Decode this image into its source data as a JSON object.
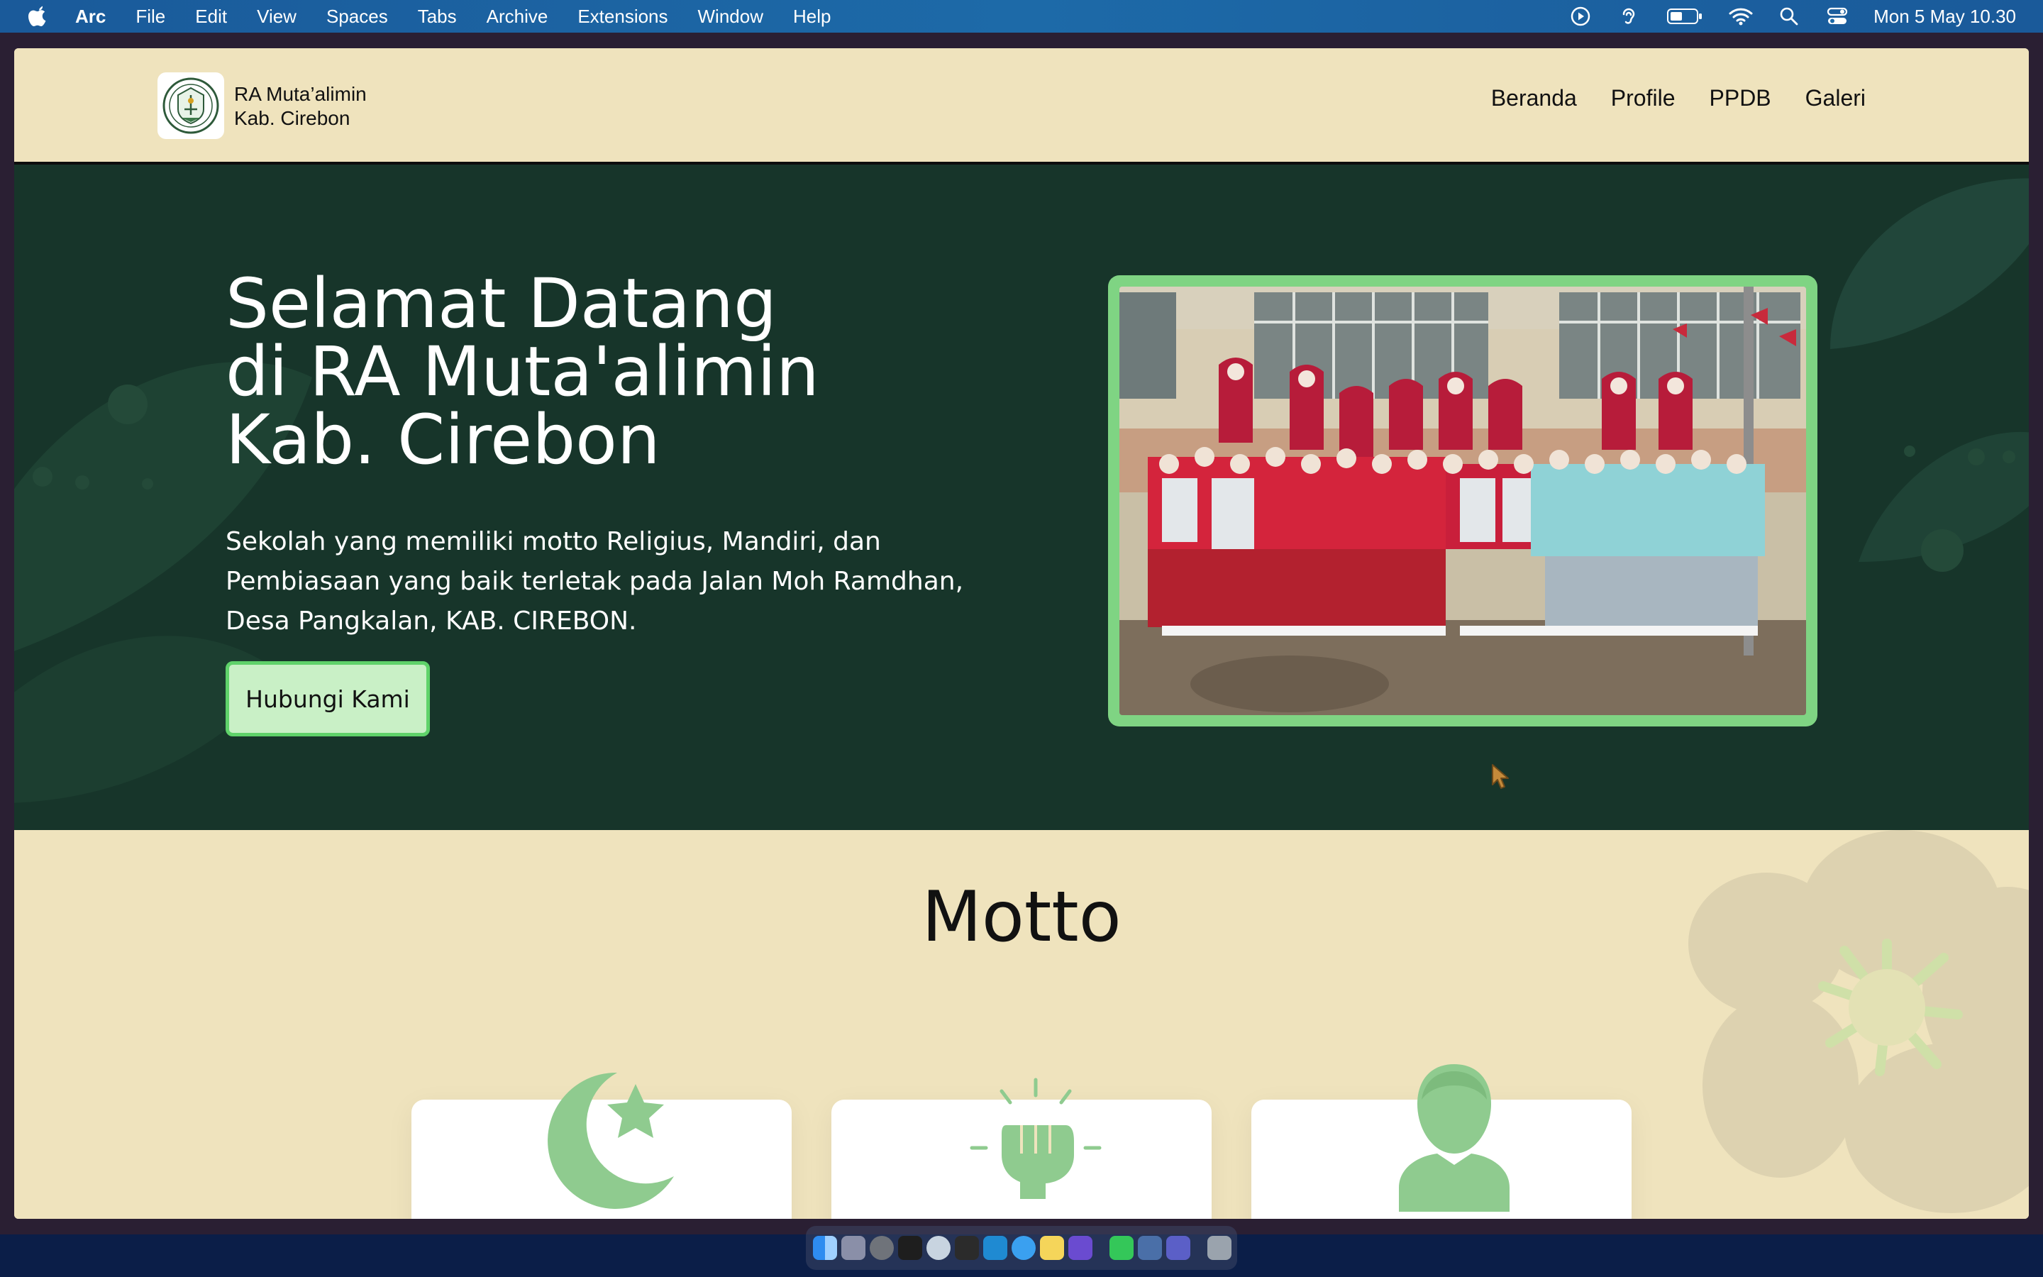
{
  "menubar": {
    "app_name": "Arc",
    "items": [
      "File",
      "Edit",
      "View",
      "Spaces",
      "Tabs",
      "Archive",
      "Extensions",
      "Window",
      "Help"
    ],
    "clock": "Mon 5 May  10.30",
    "status_icons": [
      "play-circle-icon",
      "hearing-icon",
      "battery-icon",
      "wifi-icon",
      "search-icon",
      "control-center-icon"
    ]
  },
  "site": {
    "brand_line1": "RA Muta’alimin",
    "brand_line2": "Kab. Cirebon",
    "nav": [
      "Beranda",
      "Profile",
      "PPDB",
      "Galeri"
    ]
  },
  "hero": {
    "title_lines": [
      "Selamat Datang",
      "di RA Muta'alimin",
      "Kab. Cirebon"
    ],
    "description": "Sekolah yang memiliki motto Religius, Mandiri, dan Pembiasaan yang baik terletak pada Jalan Moh Ramdhan, Desa Pangkalan, KAB. CIREBON.",
    "cta_label": "Hubungi Kami"
  },
  "motto": {
    "title": "Motto",
    "cards": [
      {
        "icon": "crescent-star-icon"
      },
      {
        "icon": "raised-fist-icon"
      },
      {
        "icon": "person-icon"
      }
    ]
  },
  "colors": {
    "hero_bg": "#17352a",
    "cream": "#efe3bd",
    "accent_green": "#7fd483",
    "icon_green": "#8fcb8f"
  },
  "dock": {
    "apps": [
      "finder-icon",
      "launchpad-icon",
      "system-settings-icon",
      "terminal-icon",
      "disk-utility-icon",
      "console-icon",
      "vscode-icon",
      "safari-icon",
      "notes-icon",
      "photo-app-icon",
      "whatsapp-icon",
      "remote-desktop-icon",
      "teams-icon",
      "trash-icon"
    ]
  }
}
